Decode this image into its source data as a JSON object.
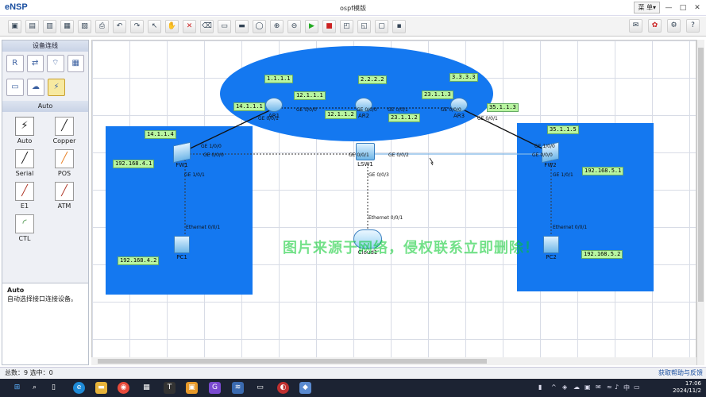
{
  "window": {
    "app_name": "eNSP",
    "title": "ospf模版",
    "menu_label": "菜 单▾",
    "minimize": "—",
    "maximize": "□",
    "close": "✕"
  },
  "toolbar": {
    "icons": [
      "new-topology",
      "new-example",
      "open",
      "save",
      "save-as",
      "print",
      "undo",
      "redo",
      "select",
      "pan",
      "delete",
      "delete-link",
      "text",
      "rectangle",
      "ellipse",
      "zoom-in",
      "zoom-out",
      "start",
      "stop",
      "capture",
      "topology",
      "grid",
      "terminal"
    ],
    "right_icons": [
      "chat",
      "huawei",
      "settings",
      "help"
    ]
  },
  "sidebar": {
    "title": "设备连线",
    "devices": [
      "router",
      "switch",
      "wireless",
      "firewall",
      "pc",
      "cloud",
      "cable"
    ],
    "section": "Auto",
    "cables": [
      {
        "label": "Auto",
        "glyph": "⚡"
      },
      {
        "label": "Copper",
        "glyph": "╱"
      },
      {
        "label": "Serial",
        "glyph": "╱"
      },
      {
        "label": "POS",
        "glyph": "╱"
      },
      {
        "label": "E1",
        "glyph": "╱"
      },
      {
        "label": "ATM",
        "glyph": "╱"
      },
      {
        "label": "CTL",
        "glyph": "◜"
      }
    ],
    "desc_title": "Auto",
    "desc_text": "自动选择接口连接设备。"
  },
  "topology": {
    "ips": {
      "ar1_lo": "1.1.1.1",
      "ar2_lo": "2.2.2.2",
      "ar3_lo": "3.3.3.3",
      "ar1_ar2": "12.1.1.1",
      "ar2_ar1": "12.1.1.2",
      "ar2_ar3": "23.1.1.2",
      "ar3_ar2": "23.1.1.3",
      "ar1_fw1": "14.1.1.1",
      "fw1_ar1": "14.1.1.4",
      "ar3_fw2": "35.1.1.3",
      "fw2_ar3": "35.1.1.5",
      "fw1_pc1": "192.168.4.1",
      "pc1": "192.168.4.2",
      "fw2_pc2": "192.168.5.1",
      "pc2": "192.168.5.2"
    },
    "ports": {
      "ar1_g000": "GE 0/0/0",
      "ar1_g001": "GE 0/0/1",
      "ar2_g000": "GE 0/0/0",
      "ar2_g001": "GE 0/0/1",
      "ar3_g000": "GE 0/0/0",
      "ar3_g001": "GE 0/0/1",
      "fw1_g100": "GE 1/0/0",
      "fw1_g000": "GE 0/0/0",
      "fw1_g101": "GE 1/0/1",
      "fw2_g100": "GE 1/0/0",
      "fw2_g000": "GE 0/0/0",
      "fw2_g101": "GE 1/0/1",
      "sw1_g001": "GE 0/0/1",
      "sw1_g002": "GE 0/0/2",
      "sw1_g003": "GE 0/0/3",
      "pc1_eth": "Ethernet 0/0/1",
      "pc2_eth": "Ethernet 0/0/1",
      "cloud_eth": "Ethernet 0/0/1"
    },
    "nodes": {
      "ar1": "AR1",
      "ar2": "AR2",
      "ar3": "AR3",
      "fw1": "FW1",
      "fw2": "FW2",
      "sw1": "LSW1",
      "pc1": "PC1",
      "pc2": "PC2",
      "cloud1": "Cloud1"
    },
    "watermark": "图片来源于网络，侵权联系立即删除！"
  },
  "status": {
    "text": "总数：9  选中：0",
    "help": "获取帮助与反馈"
  },
  "taskbar": {
    "apps": [
      "windows",
      "search",
      "task-view",
      "edge",
      "explorer",
      "chrome",
      "mail",
      "typora",
      "folder",
      "ensp",
      "wireshark",
      "vm",
      "virtualbox",
      "notes"
    ],
    "tray_text": "中",
    "time": "17:06",
    "date": "2024/11/2"
  },
  "colors": {
    "area": "#1478f0",
    "ip_label_bg": "#b8f5a0",
    "watermark": "#00c828"
  }
}
